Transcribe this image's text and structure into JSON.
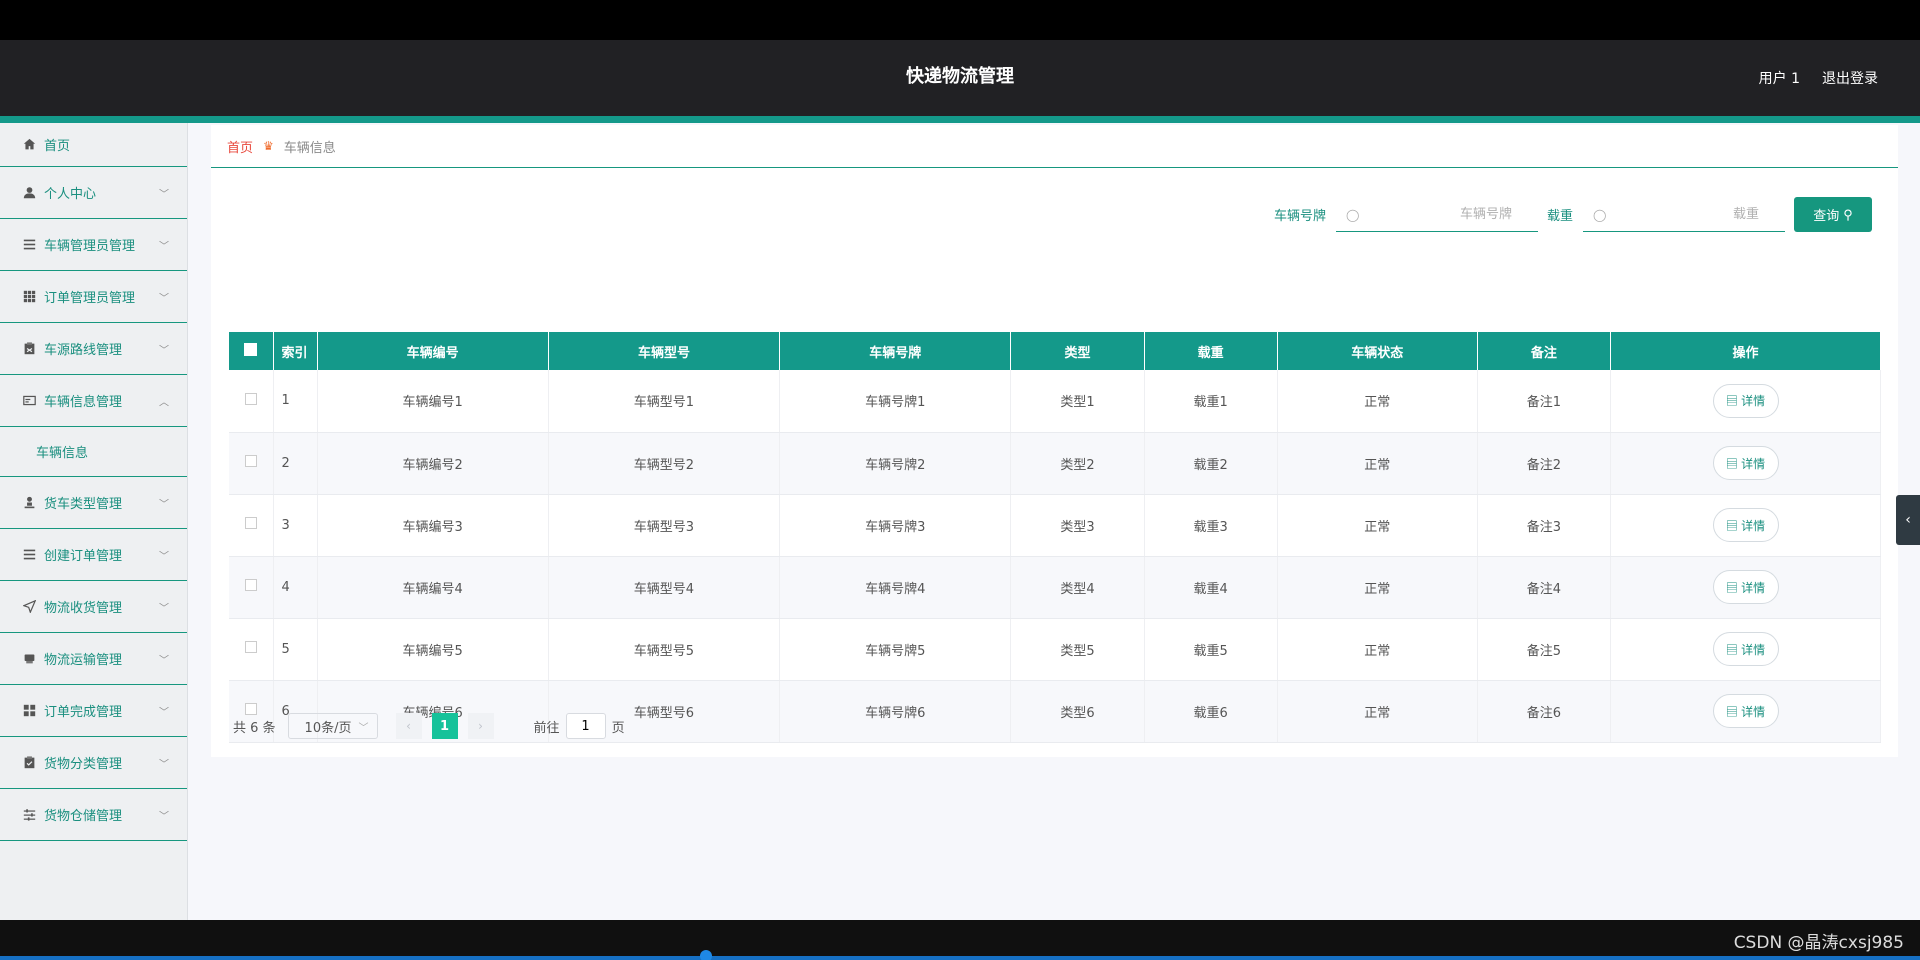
{
  "header": {
    "title": "快递物流管理",
    "user": "用户 1",
    "logout": "退出登录"
  },
  "sidebar": {
    "items": [
      {
        "label": "首页",
        "icon": "home-icon"
      },
      {
        "label": "个人中心",
        "icon": "user-icon"
      },
      {
        "label": "车辆管理员管理",
        "icon": "list-icon"
      },
      {
        "label": "订单管理员管理",
        "icon": "grid-icon"
      },
      {
        "label": "车源路线管理",
        "icon": "clipboard-icon"
      },
      {
        "label": "车辆信息管理",
        "icon": "card-icon"
      },
      {
        "label": "货车类型管理",
        "icon": "person-stand-icon"
      },
      {
        "label": "创建订单管理",
        "icon": "list-icon"
      },
      {
        "label": "物流收货管理",
        "icon": "send-icon"
      },
      {
        "label": "物流运输管理",
        "icon": "printer-icon"
      },
      {
        "label": "订单完成管理",
        "icon": "apps-icon"
      },
      {
        "label": "货物分类管理",
        "icon": "clipboard-check-icon"
      },
      {
        "label": "货物仓储管理",
        "icon": "sliders-icon"
      }
    ],
    "submenu_active": "车辆信息"
  },
  "breadcrumb": {
    "home": "首页",
    "current": "车辆信息"
  },
  "search": {
    "plate_label": "车辆号牌",
    "plate_placeholder": "车辆号牌",
    "load_label": "载重",
    "load_placeholder": "载重",
    "query_label": "查询"
  },
  "table": {
    "headers": [
      "索引",
      "车辆编号",
      "车辆型号",
      "车辆号牌",
      "类型",
      "载重",
      "车辆状态",
      "备注",
      "操作"
    ],
    "rows": [
      [
        "1",
        "车辆编号1",
        "车辆型号1",
        "车辆号牌1",
        "类型1",
        "载重1",
        "正常",
        "备注1"
      ],
      [
        "2",
        "车辆编号2",
        "车辆型号2",
        "车辆号牌2",
        "类型2",
        "载重2",
        "正常",
        "备注2"
      ],
      [
        "3",
        "车辆编号3",
        "车辆型号3",
        "车辆号牌3",
        "类型3",
        "载重3",
        "正常",
        "备注3"
      ],
      [
        "4",
        "车辆编号4",
        "车辆型号4",
        "车辆号牌4",
        "类型4",
        "载重4",
        "正常",
        "备注4"
      ],
      [
        "5",
        "车辆编号5",
        "车辆型号5",
        "车辆号牌5",
        "类型5",
        "载重5",
        "正常",
        "备注5"
      ],
      [
        "6",
        "车辆编号6",
        "车辆型号6",
        "车辆号牌6",
        "类型6",
        "载重6",
        "正常",
        "备注6"
      ]
    ],
    "detail_label": "详情"
  },
  "pager": {
    "total": "共 6 条",
    "page_size": "10条/页",
    "current_page": "1",
    "goto_prefix": "前往",
    "goto_value": "1",
    "goto_suffix": "页"
  },
  "watermark": "CSDN @晶涛cxsj985",
  "colors": {
    "accent": "#14998a",
    "topbar": "#212124",
    "page_active": "#16c29a"
  }
}
